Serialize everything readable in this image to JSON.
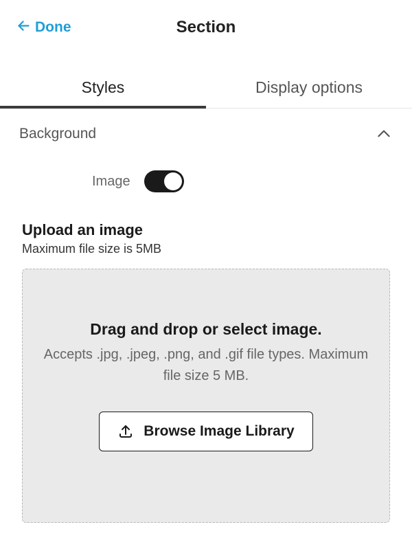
{
  "header": {
    "back_label": "Done",
    "title": "Section"
  },
  "tabs": {
    "styles": "Styles",
    "display_options": "Display options"
  },
  "background": {
    "label": "Background",
    "image_label": "Image",
    "image_enabled": true
  },
  "upload": {
    "title": "Upload an image",
    "subtitle": "Maximum file size is 5MB",
    "drop_headline": "Drag and drop or select image.",
    "drop_sub": "Accepts .jpg, .jpeg, .png, and .gif file types. Maximum file size 5 MB.",
    "browse_label": "Browse Image Library"
  }
}
